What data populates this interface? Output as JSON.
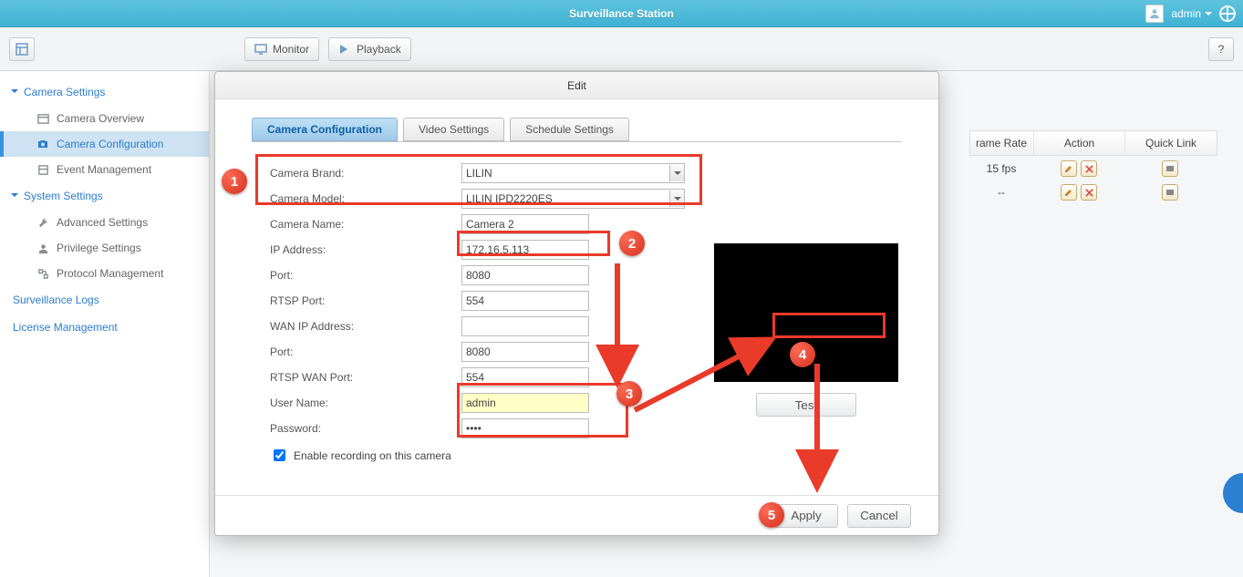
{
  "app": {
    "title": "Surveillance Station",
    "user": "admin"
  },
  "toolbar": {
    "monitor": "Monitor",
    "playback": "Playback"
  },
  "sidebar": {
    "camera_settings": "Camera Settings",
    "overview": "Camera Overview",
    "configuration": "Camera Configuration",
    "event": "Event Management",
    "system_settings": "System Settings",
    "advanced": "Advanced Settings",
    "privilege": "Privilege Settings",
    "protocol": "Protocol Management",
    "surv_logs": "Surveillance Logs",
    "license": "License Management"
  },
  "grid": {
    "cols": {
      "framerate": "rame Rate",
      "action": "Action",
      "quicklink": "Quick Link"
    },
    "rows": [
      {
        "framerate": "15 fps"
      },
      {
        "framerate": "--"
      }
    ]
  },
  "modal": {
    "title": "Edit",
    "tabs": {
      "config": "Camera Configuration",
      "video": "Video Settings",
      "schedule": "Schedule Settings"
    },
    "labels": {
      "brand": "Camera Brand:",
      "model": "Camera Model:",
      "name": "Camera Name:",
      "ip": "IP Address:",
      "port": "Port:",
      "rtsp": "RTSP Port:",
      "wanip": "WAN IP Address:",
      "port2": "Port:",
      "rtspwan": "RTSP WAN Port:",
      "user": "User Name:",
      "pass": "Password:",
      "enable": "Enable recording on this camera"
    },
    "values": {
      "brand": "LILIN",
      "model": "LILIN IPD2220ES",
      "name": "Camera 2",
      "ip": "172.16.5.113",
      "port": "8080",
      "rtsp": "554",
      "wanip": "",
      "port2": "8080",
      "rtspwan": "554",
      "user": "admin",
      "pass": "••••"
    },
    "test": "Test",
    "apply": "Apply",
    "cancel": "Cancel"
  },
  "annotations": {
    "c1": "1",
    "c2": "2",
    "c3": "3",
    "c4": "4",
    "c5": "5"
  }
}
